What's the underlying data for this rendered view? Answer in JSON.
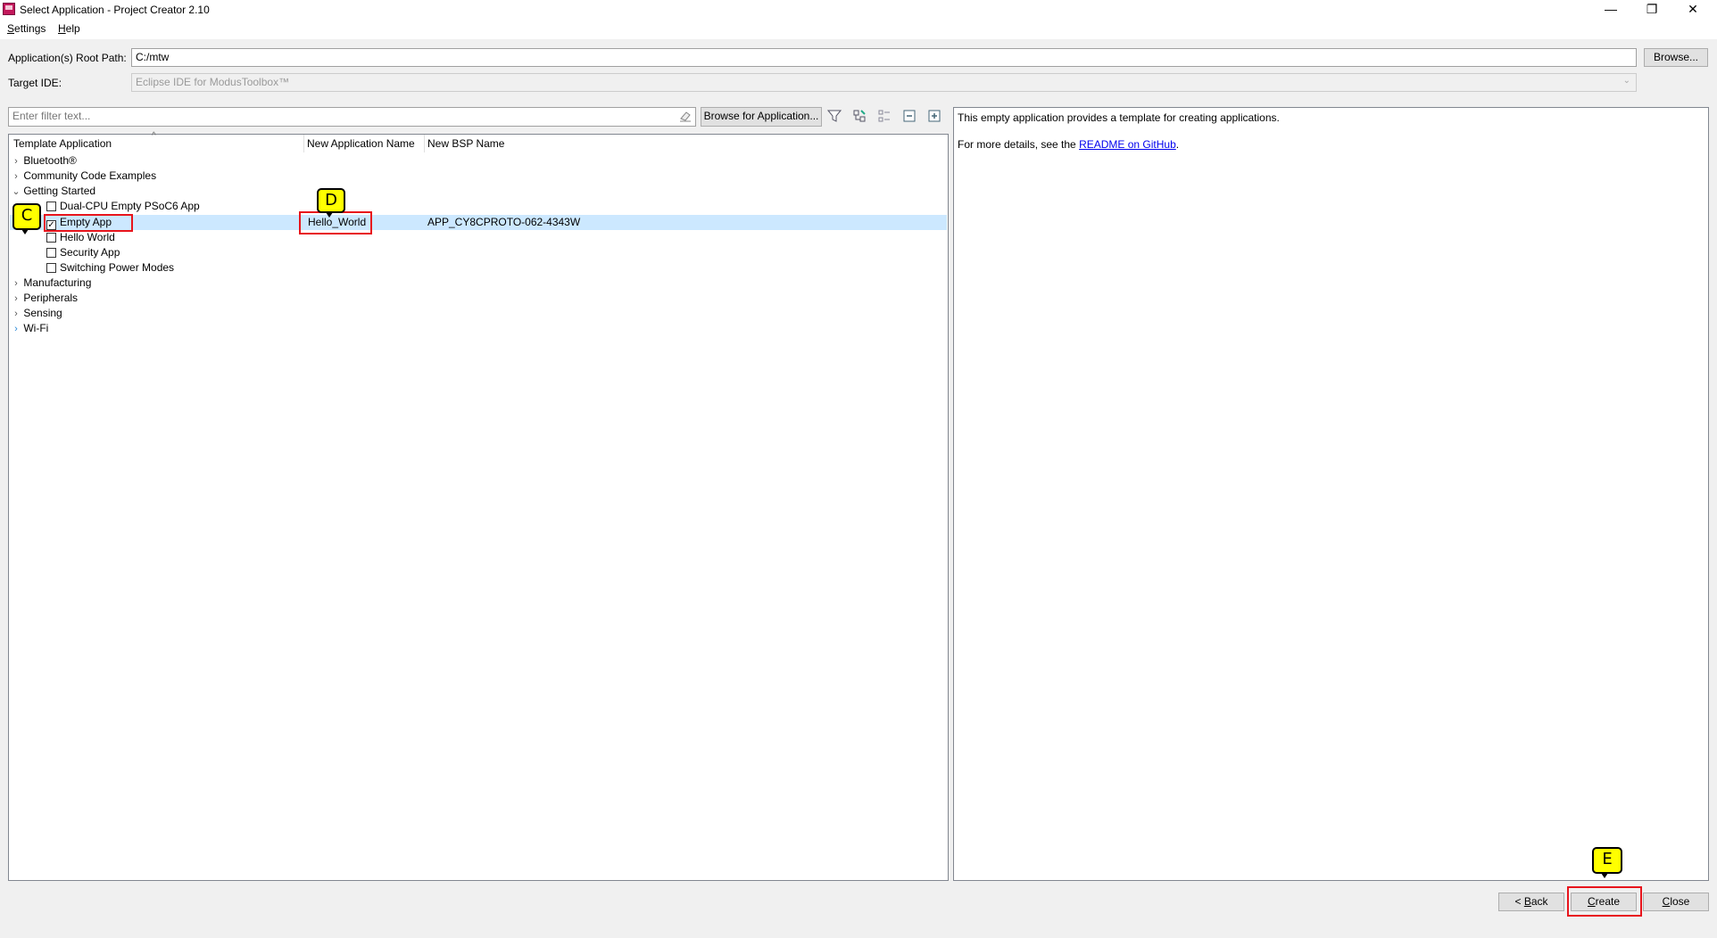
{
  "window": {
    "title": "Select Application - Project Creator 2.10",
    "controls": {
      "minimize": "—",
      "restore": "❐",
      "close": "✕"
    }
  },
  "menu": {
    "settings_first": "S",
    "settings_rest": "ettings",
    "help_first": "H",
    "help_rest": "elp"
  },
  "root_path": {
    "label": "Application(s) Root Path:",
    "value": "C:/mtw",
    "browse_label": "Browse..."
  },
  "target_ide": {
    "label": "Target IDE:",
    "value": "Eclipse IDE for ModusToolbox™"
  },
  "filter": {
    "placeholder": "Enter filter text...",
    "browse_app_label": "Browse for Application...",
    "clear_icon": "eraser-icon"
  },
  "toolbar_icons": [
    "filter-icon",
    "tree-filter-icon",
    "expand-selected-icon",
    "collapse-all-icon",
    "expand-all-icon"
  ],
  "columns": {
    "template": "Template Application",
    "new_name": "New Application Name",
    "new_bsp": "New BSP Name"
  },
  "tree": {
    "bluetooth": "Bluetooth®",
    "community": "Community Code Examples",
    "getting_started": "Getting Started",
    "dual_cpu": "Dual-CPU Empty PSoC6 App",
    "empty_app": "Empty App",
    "empty_app_name": "Hello_World",
    "empty_app_bsp": "APP_CY8CPROTO-062-4343W",
    "hello_world": "Hello World",
    "security_app": "Security App",
    "switching_power": "Switching Power Modes",
    "manufacturing": "Manufacturing",
    "peripherals": "Peripherals",
    "sensing": "Sensing",
    "wifi": "Wi-Fi"
  },
  "description": {
    "line1": "This empty application provides a template for creating applications.",
    "line2_prefix": "For more details, see the ",
    "line2_link": "README on GitHub",
    "line2_suffix": "."
  },
  "buttons": {
    "back_prefix": "< ",
    "back_first": "B",
    "back_rest": "ack",
    "create_first": "C",
    "create_rest": "reate",
    "close_first": "C",
    "close_rest": "lose"
  },
  "callouts": {
    "c": "C",
    "d": "D",
    "e": "E"
  },
  "colors": {
    "selection": "#cce8ff",
    "callout": "#ffff00",
    "highlight_border": "#e8141c",
    "link": "#0000ee"
  }
}
